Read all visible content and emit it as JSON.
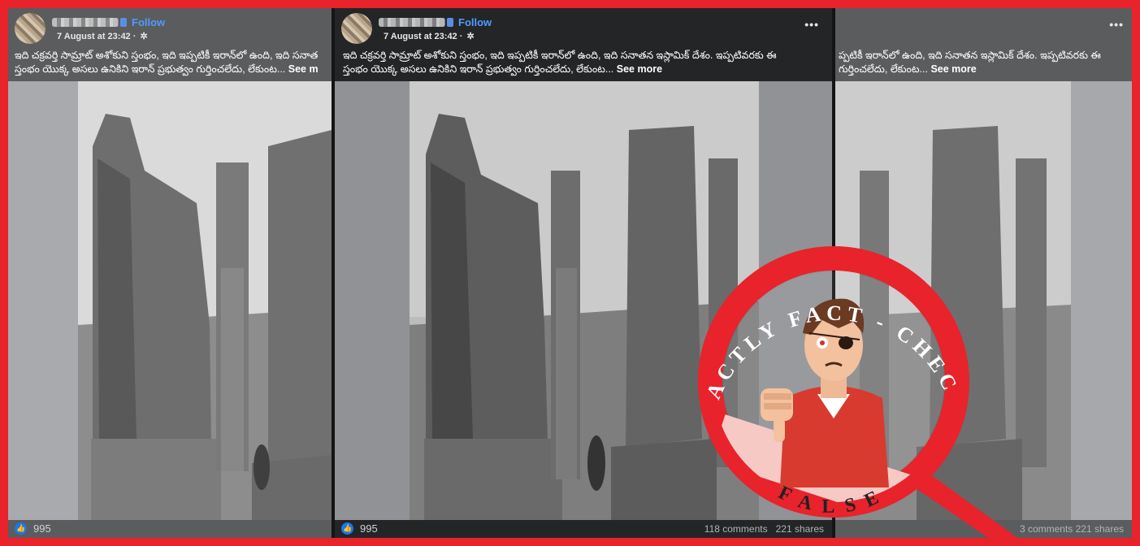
{
  "post": {
    "follow_label": "Follow",
    "date": "7 August at 23:42 ·",
    "more_icon": "•••",
    "caption_line1": "ఇది చక్రవర్తి సామ్రాట్ అశోకుని స్తంభం, ఇది ఇప్పటికీ ఇరాన్‌లో ఉంది, ఇది సనాతన ఇస్లామిక్ దేశం. ఇప్పటివరకు ఈ",
    "caption_line2": "స్తంభం యొక్క అసలు ఉనికిని ఇరాన్ ప్రభుత్వం గుర్తించలేదు, లేకుంట...",
    "see_more": "See more",
    "like_count": "995",
    "comments": "118 comments",
    "shares": "221 shares"
  },
  "left_post": {
    "caption_line1": "ఇది చక్రవర్తి సామ్రాట్ అశోకుని స్తంభం, ఇది ఇప్పటికీ ఇరాన్‌లో ఉంది, ఇది సనాత",
    "caption_line2": "స్తంభం యొక్క అసలు ఉనికిని ఇరాన్ ప్రభుత్వం గుర్తించలేదు, లేకుంట...",
    "see_more": "See m"
  },
  "right_post": {
    "caption_line1": "ప్పటికీ ఇరాన్‌లో ఉంది, ఇది సనాతన ఇస్లామిక్ దేశం. ఇప్పటివరకు ఈ",
    "caption_line2": "గుర్తించలేదు, లేకుంట...",
    "see_more": "See more",
    "stats": "3 comments   221 shares"
  },
  "stamp": {
    "arc_text": "FACTLY FACT - CHECK",
    "verdict": "FALSE",
    "red": "#e8232b",
    "pink": "#f6c9c4"
  },
  "icons": {
    "like": "thumbs-up-icon",
    "settings": "gear-icon"
  }
}
